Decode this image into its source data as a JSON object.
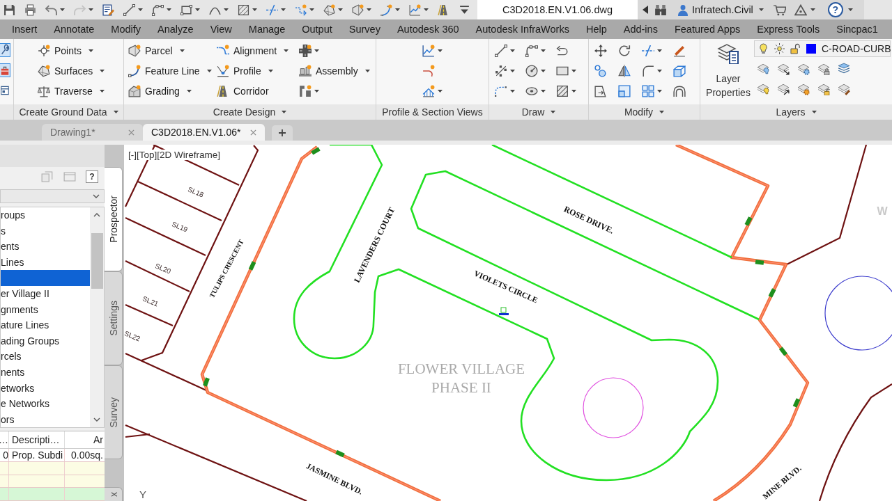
{
  "quick_access": {
    "document_title": "C3D2018.EN.V1.06.dwg",
    "user": "Infratech.Civil",
    "help": "?"
  },
  "ribbon_tabs": [
    "Insert",
    "Annotate",
    "Modify",
    "Analyze",
    "View",
    "Manage",
    "Output",
    "Survey",
    "Autodesk 360",
    "Autodesk InfraWorks",
    "Help",
    "Add-ins",
    "Featured Apps",
    "Express Tools",
    "Sincpac1"
  ],
  "ribbon_panels": [
    {
      "kind": "toggles",
      "buttons": [
        {
          "on": true
        },
        {
          "on": true
        },
        {
          "on": false
        }
      ]
    },
    {
      "kind": "labeled",
      "title": "Create Ground Data",
      "expandable": true,
      "buttons": [
        {
          "label": "Points",
          "dropdown": true
        },
        {
          "label": "Surfaces",
          "dropdown": true
        },
        {
          "label": "Traverse",
          "dropdown": true
        }
      ]
    },
    {
      "kind": "labeled",
      "title": "Create Design",
      "expandable": true,
      "buttons": [
        {
          "label": "Parcel",
          "dropdown": true
        },
        {
          "label": "Feature Line",
          "dropdown": true
        },
        {
          "label": "Grading",
          "dropdown": true
        },
        {
          "label": "Alignment",
          "dropdown": true
        },
        {
          "label": "Profile",
          "dropdown": true
        },
        {
          "label": "Corridor",
          "dropdown": false
        },
        {
          "dropdown": true
        },
        {
          "label": "Assembly",
          "dropdown": true
        },
        {
          "dropdown": true
        }
      ]
    },
    {
      "kind": "icons",
      "title": "Profile & Section Views",
      "expandable": false,
      "buttons": [
        {
          "dropdown": true
        },
        {
          "dropdown": false
        },
        {
          "dropdown": true
        }
      ]
    },
    {
      "kind": "icons",
      "title": "Draw",
      "expandable": true,
      "buttons": [
        {
          "dropdown": true
        },
        {
          "dropdown": true
        },
        {
          "dropdown": false
        },
        {
          "dropdown": true
        },
        {
          "dropdown": true
        },
        {
          "dropdown": true
        },
        {
          "dropdown": true
        },
        {
          "dropdown": true
        },
        {
          "dropdown": true
        }
      ]
    },
    {
      "kind": "icons",
      "title": "Modify",
      "expandable": true,
      "buttons": [
        {
          "dropdown": false
        },
        {
          "dropdown": false
        },
        {
          "dropdown": true
        },
        {
          "dropdown": false
        },
        {
          "dropdown": false
        },
        {
          "dropdown": false
        },
        {
          "dropdown": true
        },
        {
          "dropdown": false
        },
        {
          "dropdown": false
        },
        {
          "dropdown": false
        },
        {
          "dropdown": true
        },
        {
          "dropdown": false
        }
      ]
    },
    {
      "kind": "layers",
      "title": "Layers",
      "expandable": true,
      "buttons": [
        {
          "label": "Layer Properties"
        }
      ],
      "current_layer": {
        "name": "C-ROAD-CURB",
        "color": "#0000ff"
      }
    }
  ],
  "file_tabs": [
    {
      "label": "Drawing1*",
      "selected": false
    },
    {
      "label": "C3D2018.EN.V1.06*",
      "selected": true
    }
  ],
  "toolspace": {
    "help": "?",
    "tree": [
      {
        "label": "roups",
        "selected": false
      },
      {
        "label": "s",
        "selected": false
      },
      {
        "label": "ents",
        "selected": false
      },
      {
        "label": "Lines",
        "selected": false
      },
      {
        "selected": true
      },
      {
        "label": "er Village II",
        "selected": false
      },
      {
        "label": "gnments",
        "selected": false
      },
      {
        "label": "ature Lines",
        "selected": false
      },
      {
        "label": "ading Groups",
        "selected": false
      },
      {
        "label": "rcels",
        "selected": false
      },
      {
        "label": "nents",
        "selected": false
      },
      {
        "label": "etworks",
        "selected": false
      },
      {
        "label": "e Networks",
        "selected": false
      },
      {
        "label": "ors",
        "selected": false
      }
    ],
    "table": {
      "columns": [
        "…",
        "Descripti…",
        "Ar"
      ],
      "rows": [
        {
          "cells": [
            "0",
            "Prop. Subdi",
            "0.00sq."
          ],
          "color": "#ffffff"
        },
        {
          "color": "#fcfce4"
        },
        {
          "color": "#fcfce4"
        },
        {
          "color": "#d6f7d6"
        }
      ]
    },
    "side_tabs": [
      {
        "label": "Prospector",
        "selected": true
      },
      {
        "label": "Settings",
        "selected": false
      },
      {
        "label": "Survey",
        "selected": false
      },
      {
        "label": "x",
        "selected": false
      }
    ]
  },
  "drawing": {
    "view_label": "[-][Top][2D Wireframe]",
    "street_labels": [
      "TULIPS CRESCENT",
      "LAVENDERS COURT",
      "ROSE DRIVE.",
      "VIOLETS CIRCLE",
      "JASMINE BLVD.",
      "MINE BLVD."
    ],
    "lot_labels": [
      "SL18",
      "SL19",
      "SL20",
      "SL21",
      "SL22"
    ],
    "title_lines": [
      "FLOWER VILLAGE",
      "PHASE II"
    ],
    "viewcube_label": "W",
    "ucs_label": "Y"
  }
}
